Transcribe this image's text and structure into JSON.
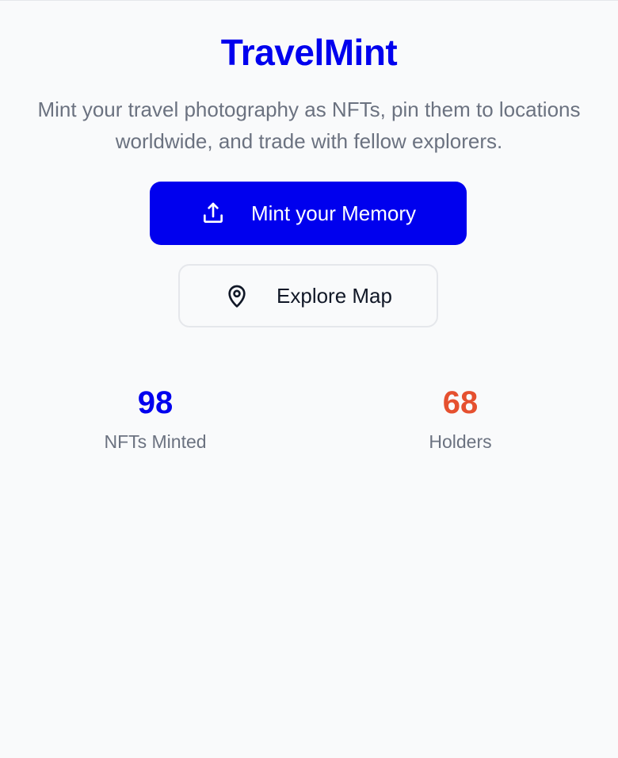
{
  "header": {
    "title": "TravelMint",
    "subtitle": "Mint your travel photography as NFTs, pin them to locations worldwide, and trade with fellow explorers."
  },
  "actions": {
    "mint_label": "Mint your Memory",
    "mint_icon": "upload-icon",
    "explore_label": "Explore Map",
    "explore_icon": "map-pin-icon"
  },
  "stats": [
    {
      "value": "98",
      "label": "NFTs Minted",
      "color": "#0000ee"
    },
    {
      "value": "68",
      "label": "Holders",
      "color": "#e5502f"
    }
  ],
  "colors": {
    "brand": "#0000ee",
    "accent": "#e5502f",
    "muted_text": "#6b7280",
    "background": "#f9fafb"
  }
}
